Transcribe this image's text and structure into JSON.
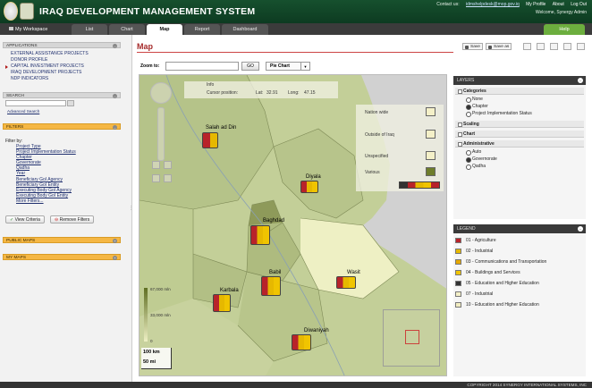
{
  "header": {
    "title": "IRAQ DEVELOPMENT MANAGEMENT SYSTEM",
    "contact_label": "Contact us:",
    "contact_email": "idmshelpdesk@mop.gov.iq",
    "links": [
      "My Profile",
      "About",
      "Log Out"
    ],
    "welcome": "Welcome, Synergy Admin"
  },
  "nav": {
    "workspace": "My Workspace",
    "tabs": [
      "List",
      "Chart",
      "Map",
      "Report",
      "Dashboard"
    ],
    "active_tab": "Map",
    "help": "Help"
  },
  "left": {
    "applications_label": "APPLICATIONS",
    "applications": [
      "EXTERNAL ASSISTANCE PROJECTS",
      "DONOR PROFILE",
      "CAPITAL INVESTMENT PROJECTS",
      "IRAQ DEVELOPMENT PROJECTS",
      "NDP INDICATORS"
    ],
    "search_label": "SEARCH",
    "advanced_search": "Advanced Search",
    "filters_label": "FILTERS",
    "filter_by": "Filter by:",
    "filters": [
      "Project Type",
      "Project Implementation Status",
      "Chapter",
      "Governorate",
      "Qadha",
      "Year",
      "Beneficiary GoI Agency",
      "Beneficiary GoI Entity",
      "Executing Body GoI Agency",
      "Executing Body GoI Entity",
      "More Filters..."
    ],
    "view_criteria": "View Criteria",
    "remove_filters": "Remove Filters",
    "public_maps": "PUBLIC MAPS",
    "my_maps": "MY MAPS"
  },
  "main": {
    "title": "Map",
    "save": "Save",
    "save_as": "Save as",
    "zoom_to": "Zoom to:",
    "zoom_value": "",
    "go": "GO",
    "chart_type": "Pie Chart"
  },
  "map": {
    "info_label": "Info",
    "cursor_label": "Cursor position:",
    "lat_label": "Lat:",
    "lat": "32.91",
    "long_label": "Long:",
    "long": "47.15",
    "places": [
      "Salah ad Din",
      "Diyala",
      "Baghdad",
      "Babil",
      "Wasit",
      "Karbala",
      "Diwaniyah"
    ],
    "legend_rows": [
      "Nation wide",
      "Outside of Iraq",
      "Unspecified",
      "Various"
    ],
    "scale_top": "67,000 mln",
    "scale_mid": "33,000 mln",
    "scale_low": "0",
    "scale_km": "100 km",
    "scale_mi": "50 mi"
  },
  "layers": {
    "title": "LAYERS",
    "categories_label": "Categories",
    "categories_options": [
      "None",
      "Chapter",
      "Project Implementation Status"
    ],
    "categories_selected": "Chapter",
    "scaling": "Scaling",
    "chart": "Chart",
    "administrative_label": "Administrative",
    "admin_options": [
      "Auto",
      "Governorate",
      "Qadha"
    ],
    "admin_selected": "Governorate"
  },
  "legend": {
    "title": "LEGEND",
    "items": [
      {
        "label": "01 - Agriculture",
        "color": "#b8232a"
      },
      {
        "label": "02 - Industrial",
        "color": "#e6b800"
      },
      {
        "label": "03 - Communications and Transportation",
        "color": "#e6a800"
      },
      {
        "label": "04 - Buildings and Services",
        "color": "#f0c400"
      },
      {
        "label": "05 - Education and Higher Education",
        "color": "#333333"
      },
      {
        "label": "07 - Industrial",
        "color": "#f4f0c8"
      },
      {
        "label": "10 - Education and Higher Education",
        "color": "#f2edc2"
      }
    ]
  },
  "footer": "COPYRIGHT 2014 SYNERGY INTERNATIONAL SYSTEMS, INC"
}
